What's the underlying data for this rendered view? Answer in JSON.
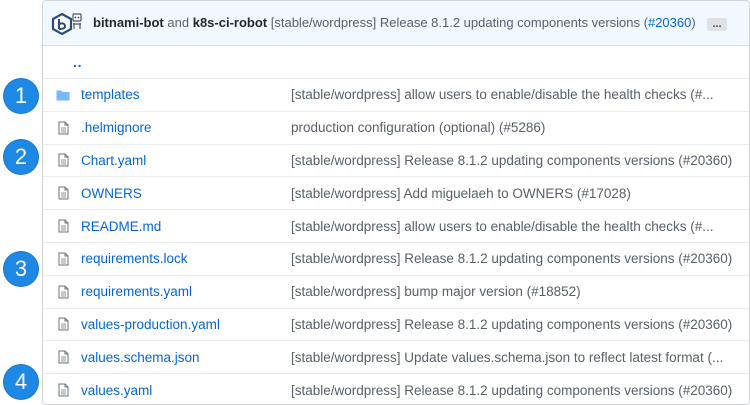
{
  "commit": {
    "author1": "bitnami-bot",
    "and": "and",
    "author2": "k8s-ci-robot",
    "message": "[stable/wordpress] Release 8.1.2 updating components versions (",
    "link": "#20360",
    "close": ")",
    "more": "..."
  },
  "up_link": "..",
  "files": [
    {
      "name": "templates",
      "type": "folder",
      "message": "[stable/wordpress] allow users to enable/disable the health checks (#..."
    },
    {
      "name": ".helmignore",
      "type": "file",
      "message": "production configuration (optional) (#5286)"
    },
    {
      "name": "Chart.yaml",
      "type": "file",
      "message": "[stable/wordpress] Release 8.1.2 updating components versions (#20360)"
    },
    {
      "name": "OWNERS",
      "type": "file",
      "message": "[stable/wordpress] Add miguelaeh to OWNERS (#17028)"
    },
    {
      "name": "README.md",
      "type": "file",
      "message": "[stable/wordpress] allow users to enable/disable the health checks (#..."
    },
    {
      "name": "requirements.lock",
      "type": "file",
      "message": "[stable/wordpress] Release 8.1.2 updating components versions (#20360)"
    },
    {
      "name": "requirements.yaml",
      "type": "file",
      "message": "[stable/wordpress] bump major version (#18852)"
    },
    {
      "name": "values-production.yaml",
      "type": "file",
      "message": "[stable/wordpress] Release 8.1.2 updating components versions (#20360)"
    },
    {
      "name": "values.schema.json",
      "type": "file",
      "message": "[stable/wordpress] Update values.schema.json to reflect latest format (..."
    },
    {
      "name": "values.yaml",
      "type": "file",
      "message": "[stable/wordpress] Release 8.1.2 updating components versions (#20360)"
    }
  ],
  "badges": [
    "1",
    "2",
    "3",
    "4"
  ],
  "colors": {
    "link": "#0366d6",
    "badge": "#1e88e5",
    "commit_bg": "#f1f8ff"
  }
}
